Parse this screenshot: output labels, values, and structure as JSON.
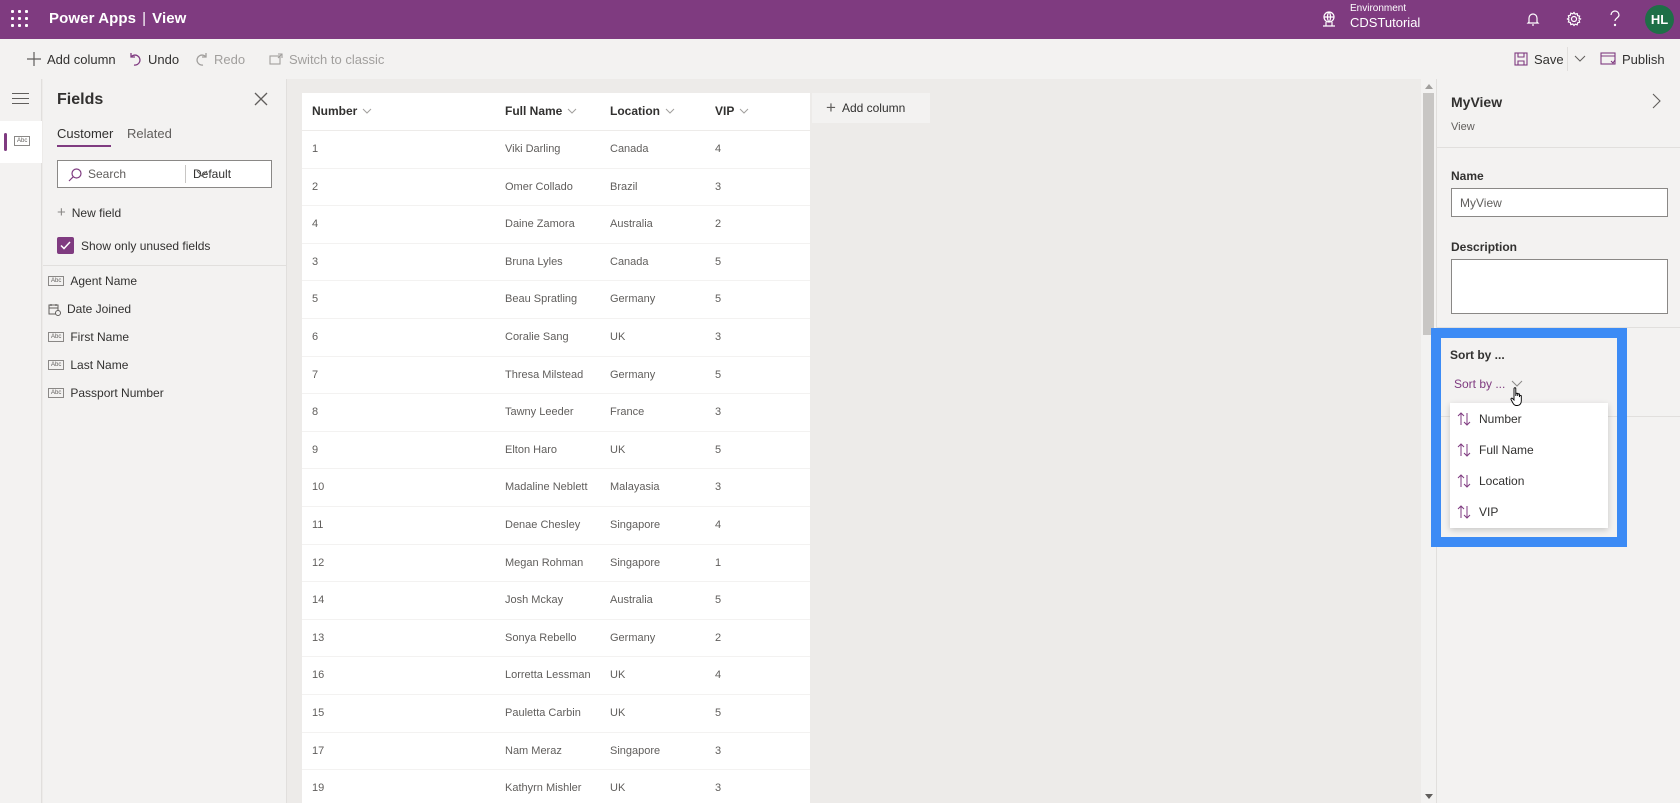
{
  "topbar": {
    "app_name": "Power Apps",
    "separator": "|",
    "page_name": "View",
    "environment_label": "Environment",
    "environment_name": "CDSTutorial",
    "avatar_initials": "HL",
    "brand_color": "#7f3b80"
  },
  "commandbar": {
    "add_column": "Add column",
    "undo": "Undo",
    "redo": "Redo",
    "switch_classic": "Switch to classic",
    "save": "Save",
    "publish": "Publish"
  },
  "fields_panel": {
    "title": "Fields",
    "tabs": [
      {
        "label": "Customer",
        "active": true
      },
      {
        "label": "Related",
        "active": false
      }
    ],
    "search_placeholder": "Search",
    "filter_value": "Default",
    "new_field": "New field",
    "show_unused_label": "Show only unused fields",
    "show_unused_checked": true,
    "items": [
      {
        "label": "Agent Name",
        "icon": "text-field-icon"
      },
      {
        "label": "Date Joined",
        "icon": "date-field-icon"
      },
      {
        "label": "First Name",
        "icon": "text-field-icon"
      },
      {
        "label": "Last Name",
        "icon": "text-field-icon"
      },
      {
        "label": "Passport Number",
        "icon": "text-field-icon"
      }
    ]
  },
  "grid": {
    "columns": [
      "Number",
      "Full Name",
      "Location",
      "VIP"
    ],
    "add_column": "Add column",
    "rows": [
      [
        "1",
        "Viki Darling",
        "Canada",
        "4"
      ],
      [
        "2",
        "Omer Collado",
        "Brazil",
        "3"
      ],
      [
        "4",
        "Daine Zamora",
        "Australia",
        "2"
      ],
      [
        "3",
        "Bruna Lyles",
        "Canada",
        "5"
      ],
      [
        "5",
        "Beau Spratling",
        "Germany",
        "5"
      ],
      [
        "6",
        "Coralie Sang",
        "UK",
        "3"
      ],
      [
        "7",
        "Thresa Milstead",
        "Germany",
        "5"
      ],
      [
        "8",
        "Tawny Leeder",
        "France",
        "3"
      ],
      [
        "9",
        "Elton Haro",
        "UK",
        "5"
      ],
      [
        "10",
        "Madaline Neblett",
        "Malayasia",
        "3"
      ],
      [
        "11",
        "Denae Chesley",
        "Singapore",
        "4"
      ],
      [
        "12",
        "Megan Rohman",
        "Singapore",
        "1"
      ],
      [
        "14",
        "Josh Mckay",
        "Australia",
        "5"
      ],
      [
        "13",
        "Sonya Rebello",
        "Germany",
        "2"
      ],
      [
        "16",
        "Lorretta Lessman",
        "UK",
        "4"
      ],
      [
        "15",
        "Pauletta Carbin",
        "UK",
        "5"
      ],
      [
        "17",
        "Nam Meraz",
        "Singapore",
        "3"
      ],
      [
        "19",
        "Kathyrn Mishler",
        "UK",
        "3"
      ]
    ]
  },
  "properties_panel": {
    "title": "MyView",
    "subtitle": "View",
    "name_label": "Name",
    "name_value": "MyView",
    "description_label": "Description",
    "description_value": "",
    "sort_label": "Sort by ...",
    "sort_dropdown_value": "Sort by ...",
    "sort_options": [
      "Number",
      "Full Name",
      "Location",
      "VIP"
    ],
    "highlight_color": "#3c8bf5"
  }
}
